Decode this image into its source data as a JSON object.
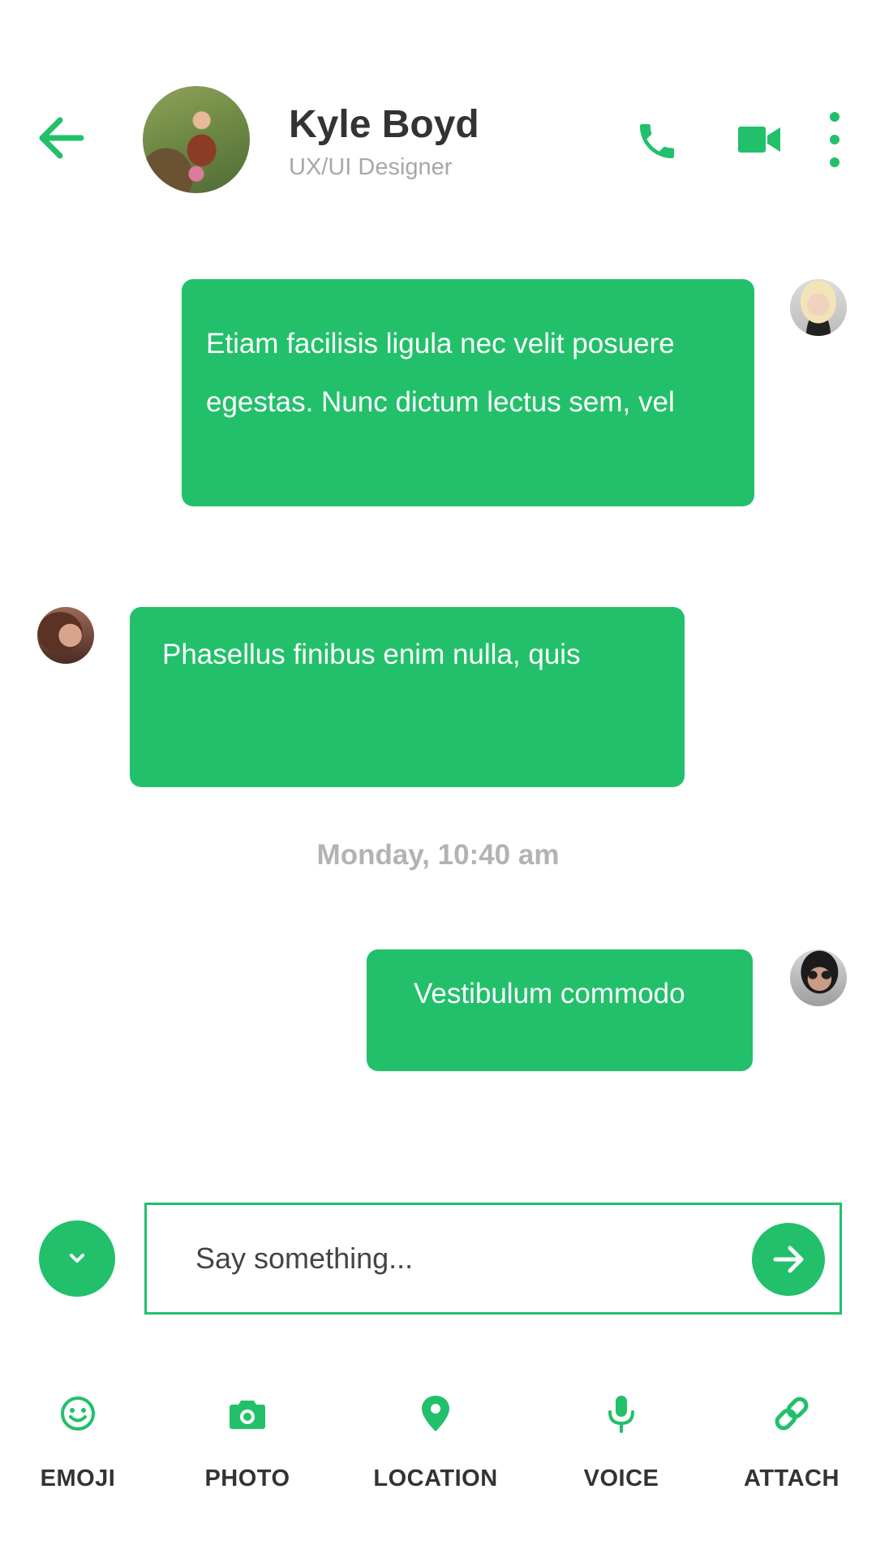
{
  "header": {
    "contact_name": "Kyle Boyd",
    "contact_role": "UX/UI Designer",
    "icons": {
      "back": "back-arrow-icon",
      "call": "phone-icon",
      "video": "video-camera-icon",
      "more": "more-vertical-icon"
    }
  },
  "messages": [
    {
      "direction": "outgoing",
      "lines": [
        "Etiam facilisis ligula nec velit posuere",
        "egestas. Nunc dictum lectus sem, vel"
      ]
    },
    {
      "direction": "incoming",
      "text": "Phasellus finibus enim nulla, quis"
    },
    {
      "direction": "outgoing",
      "text": "Vestibulum commodo"
    }
  ],
  "timestamp": "Monday, 10:40 am",
  "composer": {
    "placeholder": "Say something...",
    "value": ""
  },
  "toolbar": {
    "items": [
      {
        "label": "EMOJI",
        "icon": "emoji-icon"
      },
      {
        "label": "PHOTO",
        "icon": "camera-icon"
      },
      {
        "label": "LOCATION",
        "icon": "location-pin-icon"
      },
      {
        "label": "VOICE",
        "icon": "microphone-icon"
      },
      {
        "label": "ATTACH",
        "icon": "link-icon"
      }
    ]
  },
  "colors": {
    "accent": "#22c06a",
    "title_text": "#333333",
    "muted_text": "#a8a8a8",
    "timestamp_text": "#b3b3b3",
    "background": "#ffffff"
  }
}
